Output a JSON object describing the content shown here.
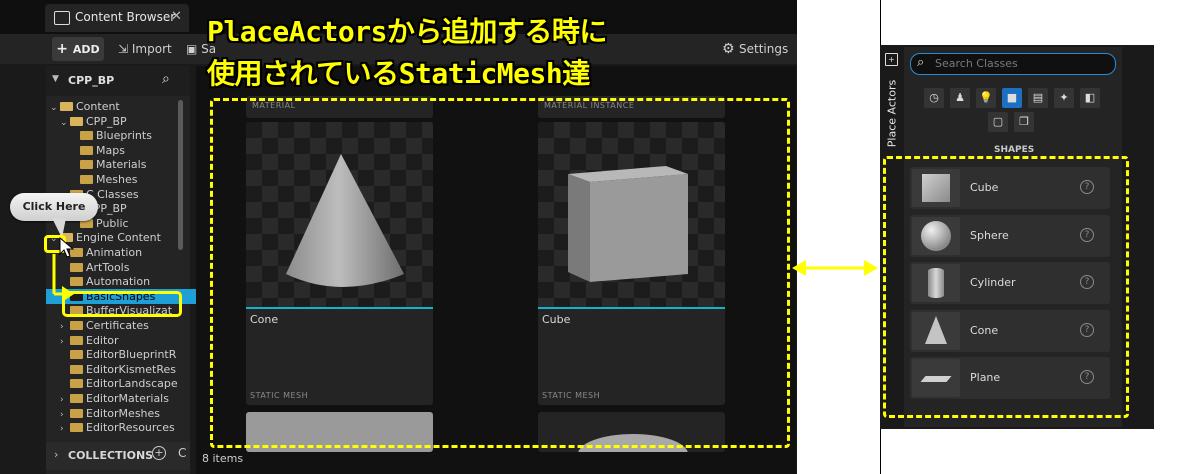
{
  "content_browser": {
    "tab_title": "Content Browser",
    "toolbar": {
      "add": "ADD",
      "import": "Import",
      "save": "Sa",
      "settings": "Settings"
    },
    "path_bar": {
      "path_label": "Ba"
    },
    "sidebar": {
      "root": "CPP_BP",
      "tree": [
        {
          "label": "Content",
          "level": 0,
          "expanded": true
        },
        {
          "label": "CPP_BP",
          "level": 1,
          "expanded": true
        },
        {
          "label": "Blueprints",
          "level": 2
        },
        {
          "label": "Maps",
          "level": 2
        },
        {
          "label": "Materials",
          "level": 2
        },
        {
          "label": "Meshes",
          "level": 2
        },
        {
          "label": "C Classes",
          "level": 1
        },
        {
          "label": "CPP_BP",
          "level": 1
        },
        {
          "label": "Public",
          "level": 2
        },
        {
          "label": "Engine Content",
          "level": 0,
          "expanded": true
        },
        {
          "label": "Animation",
          "level": 1
        },
        {
          "label": "ArtTools",
          "level": 1
        },
        {
          "label": "Automation",
          "level": 1
        },
        {
          "label": "BasicShapes",
          "level": 1,
          "selected": true
        },
        {
          "label": "BufferVisualizat",
          "level": 1
        },
        {
          "label": "Certificates",
          "level": 1
        },
        {
          "label": "Editor",
          "level": 1
        },
        {
          "label": "EditorBlueprintR",
          "level": 1
        },
        {
          "label": "EditorKismetRes",
          "level": 1
        },
        {
          "label": "EditorLandscape",
          "level": 1
        },
        {
          "label": "EditorMaterials",
          "level": 1
        },
        {
          "label": "EditorMeshes",
          "level": 1
        },
        {
          "label": "EditorResources",
          "level": 1
        }
      ],
      "collections": "COLLECTIONS"
    },
    "assets": {
      "top_labels": [
        "MATERIAL",
        "MATERIAL INSTANCE"
      ],
      "tiles": [
        {
          "name": "Cone",
          "type": "STATIC MESH"
        },
        {
          "name": "Cube",
          "type": "STATIC MESH"
        }
      ],
      "item_count": "8 items"
    }
  },
  "place_actors": {
    "tab_label": "Place Actors",
    "search_placeholder": "Search Classes",
    "section": "SHAPES",
    "shapes": [
      "Cube",
      "Sphere",
      "Cylinder",
      "Cone",
      "Plane"
    ],
    "peek_label": "ow"
  },
  "annotations": {
    "headline_line1": "PlaceActorsから追加する時に",
    "headline_line2": "使用されているStaticMesh達",
    "click_here": "Click Here"
  },
  "colors": {
    "highlight": "#ffff00",
    "accent": "#13b4c8",
    "selected_row": "#1e9fd6"
  }
}
